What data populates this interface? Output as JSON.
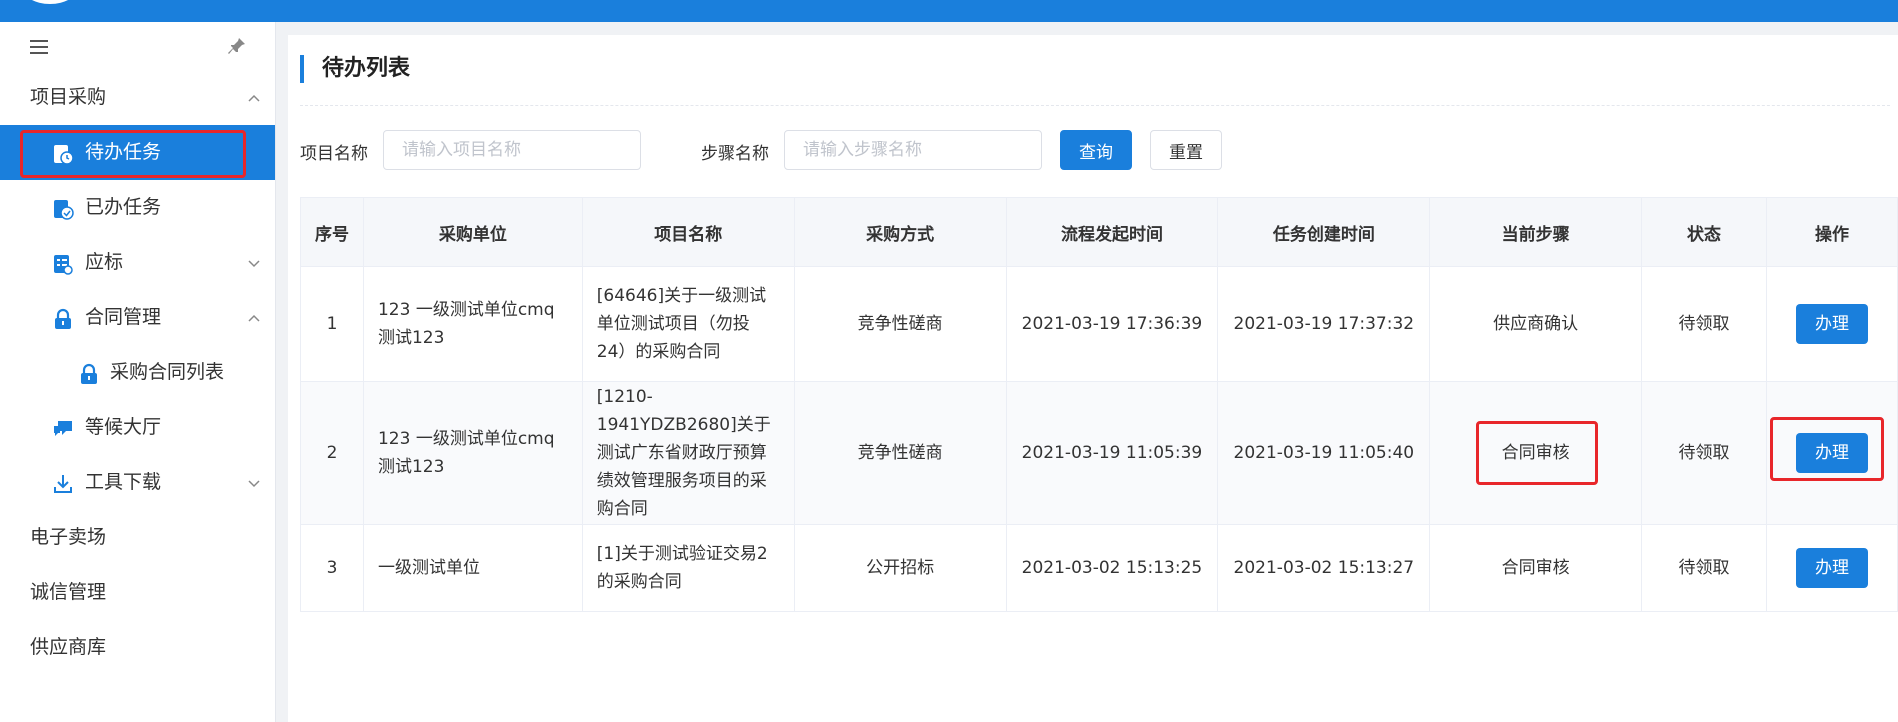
{
  "sidebar": {
    "items": [
      {
        "label": "项目采购",
        "level": 0,
        "chevron": "up"
      },
      {
        "label": "待办任务",
        "level": 1,
        "active": true,
        "icon": "task-todo-icon"
      },
      {
        "label": "已办任务",
        "level": 1,
        "icon": "task-done-icon"
      },
      {
        "label": "应标",
        "level": 1,
        "chevron": "down",
        "icon": "bid-icon"
      },
      {
        "label": "合同管理",
        "level": 1,
        "chevron": "up",
        "icon": "lock-icon"
      },
      {
        "label": "采购合同列表",
        "level": 2,
        "icon": "lock-icon"
      },
      {
        "label": "等候大厅",
        "level": 1,
        "icon": "chat-icon"
      },
      {
        "label": "工具下载",
        "level": 1,
        "chevron": "down",
        "icon": "download-icon"
      },
      {
        "label": "电子卖场",
        "level": 0
      },
      {
        "label": "诚信管理",
        "level": 0
      },
      {
        "label": "供应商库",
        "level": 0
      }
    ]
  },
  "main": {
    "title": "待办列表",
    "filters": {
      "project_label": "项目名称",
      "project_placeholder": "请输入项目名称",
      "step_label": "步骤名称",
      "step_placeholder": "请输入步骤名称",
      "query_label": "查询",
      "reset_label": "重置"
    },
    "table": {
      "columns": [
        "序号",
        "采购单位",
        "项目名称",
        "采购方式",
        "流程发起时间",
        "任务创建时间",
        "当前步骤",
        "状态",
        "操作"
      ],
      "rows": [
        {
          "no": "1",
          "unit": "123 一级测试单位cmq测试123",
          "project": "[64646]关于一级测试单位测试项目（勿投24）的采购合同",
          "method": "竞争性磋商",
          "start": "2021-03-19 17:36:39",
          "created": "2021-03-19 17:37:32",
          "step": "供应商确认",
          "status": "待领取",
          "action": "办理"
        },
        {
          "no": "2",
          "unit": "123 一级测试单位cmq测试123",
          "project": "[1210-1941YDZB2680]关于测试广东省财政厅预算绩效管理服务项目的采购合同",
          "method": "竞争性磋商",
          "start": "2021-03-19 11:05:39",
          "created": "2021-03-19 11:05:40",
          "step": "合同审核",
          "status": "待领取",
          "action": "办理"
        },
        {
          "no": "3",
          "unit": "一级测试单位",
          "project": "[1]关于测试验证交易2的采购合同",
          "method": "公开招标",
          "start": "2021-03-02 15:13:25",
          "created": "2021-03-02 15:13:27",
          "step": "合同审核",
          "status": "待领取",
          "action": "办理"
        }
      ]
    }
  },
  "colors": {
    "primary": "#1a7fdc",
    "highlight": "#e8262a"
  }
}
